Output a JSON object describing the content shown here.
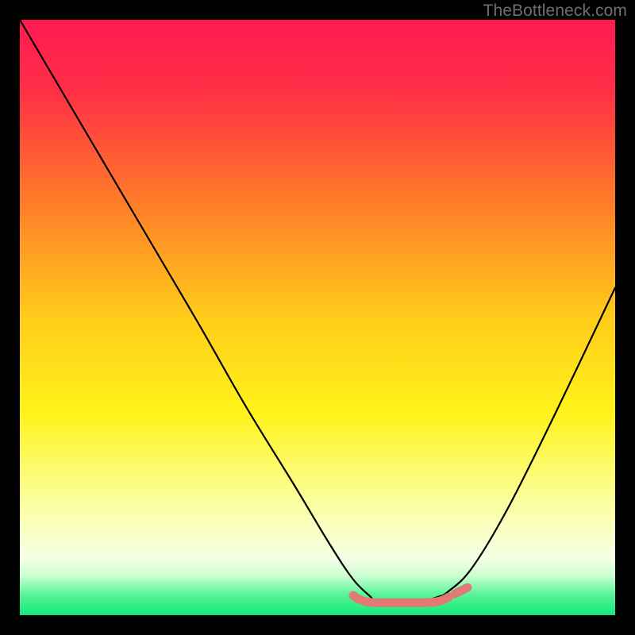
{
  "watermark": "TheBottleneck.com",
  "chart_data": {
    "type": "line",
    "title": "",
    "xlabel": "",
    "ylabel": "",
    "xlim": [
      0,
      100
    ],
    "ylim": [
      0,
      100
    ],
    "gradient_stops": [
      {
        "pos": 0,
        "color": "#ff1a54"
      },
      {
        "pos": 0.12,
        "color": "#ff2f45"
      },
      {
        "pos": 0.3,
        "color": "#ff7a2a"
      },
      {
        "pos": 0.5,
        "color": "#ffcc1a"
      },
      {
        "pos": 0.66,
        "color": "#fff31a"
      },
      {
        "pos": 0.82,
        "color": "#fbffa7"
      },
      {
        "pos": 0.905,
        "color": "#f5ffe6"
      },
      {
        "pos": 0.935,
        "color": "#c8ffd0"
      },
      {
        "pos": 0.965,
        "color": "#59f598"
      },
      {
        "pos": 1.0,
        "color": "#14e879"
      }
    ],
    "series": [
      {
        "name": "bottleneck-curve",
        "x": [
          0,
          10,
          20,
          30,
          38,
          46,
          52,
          56,
          59,
          60,
          62,
          66,
          70,
          72,
          76,
          82,
          90,
          100
        ],
        "values": [
          100,
          83,
          66,
          49,
          35,
          22,
          12,
          6,
          3,
          2,
          2,
          2,
          3,
          4,
          8,
          18,
          34,
          55
        ]
      }
    ],
    "flat_region": {
      "x_start": 56,
      "x_end": 72,
      "y": 2.5,
      "marker_color": "#e17975"
    }
  }
}
